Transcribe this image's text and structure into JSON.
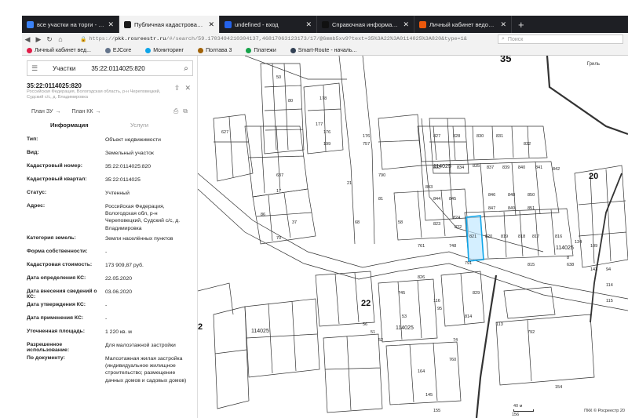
{
  "browser": {
    "tabs": [
      {
        "title": "все участки на торги - Google",
        "fav": "#3b82f6",
        "active": false
      },
      {
        "title": "Публичная кадастровая карта",
        "fav": "#1b1b1b",
        "active": true
      },
      {
        "title": "undefined - вход",
        "fav": "#2563eb",
        "active": false
      },
      {
        "title": "Справочная информация по",
        "fav": "#111111",
        "active": false
      },
      {
        "title": "Личный кабинет ведомства",
        "fav": "#ea580c",
        "active": false
      }
    ],
    "url_prefix": "https://",
    "url_host": "pkk.rosreestr.ru",
    "url_path": "/#/search/59.1703494210304137,46817063123173/17/@6mmb5xv9?text=35%3A22%3A0114025%3A820&type=1&",
    "search_placeholder": "Поиск",
    "bookmarks": [
      {
        "label": "Личный кабинет вед...",
        "color": "#e11d48"
      },
      {
        "label": "EJCore",
        "color": "#64748b"
      },
      {
        "label": "Мониторинг",
        "color": "#0ea5e9"
      },
      {
        "label": "Полтава 3",
        "color": "#a16207"
      },
      {
        "label": "Платежи",
        "color": "#16a34a"
      },
      {
        "label": "Smart-Route - началь...",
        "color": "#334155"
      }
    ]
  },
  "panel": {
    "search_category": "Участки",
    "search_value": "35:22:0114025:820",
    "cad_number": "35:22:0114025:820",
    "address_caption": "Российская Федерация, Вологодская область, р-н Череповецкий, Судский с/с, д. Владимировка",
    "plan_zu": "План ЗУ",
    "plan_kk": "План КК",
    "tab_info": "Информация",
    "tab_services": "Услуги",
    "properties": [
      {
        "k": "Тип:",
        "v": "Объект недвижимости"
      },
      {
        "k": "Вид:",
        "v": "Земельный участок"
      },
      {
        "k": "Кадастровый номер:",
        "v": "35:22:0114025:820"
      },
      {
        "k": "Кадастровый квартал:",
        "v": "35:22:0114025"
      },
      {
        "k": "Статус:",
        "v": "Учтенный"
      },
      {
        "k": "Адрес:",
        "v": "Российская Федерация, Вологодская обл, р-н Череповецкий, Судский с/с, д. Владимировка"
      },
      {
        "k": "Категория земель:",
        "v": "Земли населённых пунктов"
      },
      {
        "k": "Форма собственности:",
        "v": "-"
      },
      {
        "k": "Кадастровая стоимость:",
        "v": "173 909,87 руб."
      },
      {
        "k": "Дата определения КС:",
        "v": "22.05.2020"
      },
      {
        "k": "Дата внесения сведений о КС:",
        "v": "03.06.2020"
      },
      {
        "k": "Дата утверждения КС:",
        "v": "-"
      },
      {
        "k": "Дата применения КС:",
        "v": "-"
      },
      {
        "k": "Уточненная площадь:",
        "v": "1 220 кв. м"
      },
      {
        "k": "Разрешенное использование:",
        "v": "Для малоэтажной застройки"
      },
      {
        "k": "По документу:",
        "v": "Малоэтажная жилая застройка (индивидуальное жилищное строительство; размещение дачных домов и садовых домов)"
      }
    ]
  },
  "map": {
    "block_label": "35",
    "right_block_label": "20",
    "quarter_labels": [
      "114025",
      "114025",
      "114025",
      "114025"
    ],
    "left_number": "2",
    "mid_number": "22",
    "parcel_labels": [
      "50",
      "80",
      "178",
      "177",
      "176",
      "199",
      "627",
      "757",
      "827",
      "828",
      "830",
      "831",
      "832",
      "833",
      "834",
      "835",
      "837",
      "839",
      "840",
      "841",
      "842",
      "843",
      "844",
      "845",
      "846",
      "848",
      "850",
      "847",
      "849",
      "851",
      "824",
      "823",
      "822",
      "821",
      "820",
      "819",
      "818",
      "817",
      "816",
      "815",
      "638",
      "637",
      "17",
      "21",
      "37",
      "86",
      "70",
      "81",
      "58",
      "68",
      "748",
      "761",
      "791",
      "826",
      "829",
      "814",
      "113",
      "792",
      "74",
      "760",
      "164",
      "154",
      "155",
      "145",
      "156",
      "8",
      "134",
      "109",
      "143",
      "94",
      "114",
      "115",
      "116",
      "95",
      "56",
      "51",
      "52",
      "53",
      "745",
      "790",
      "176",
      "757"
    ],
    "selected_parcel": "820",
    "scale": "40 м",
    "credits": "ПКК © Росреестр 20"
  }
}
